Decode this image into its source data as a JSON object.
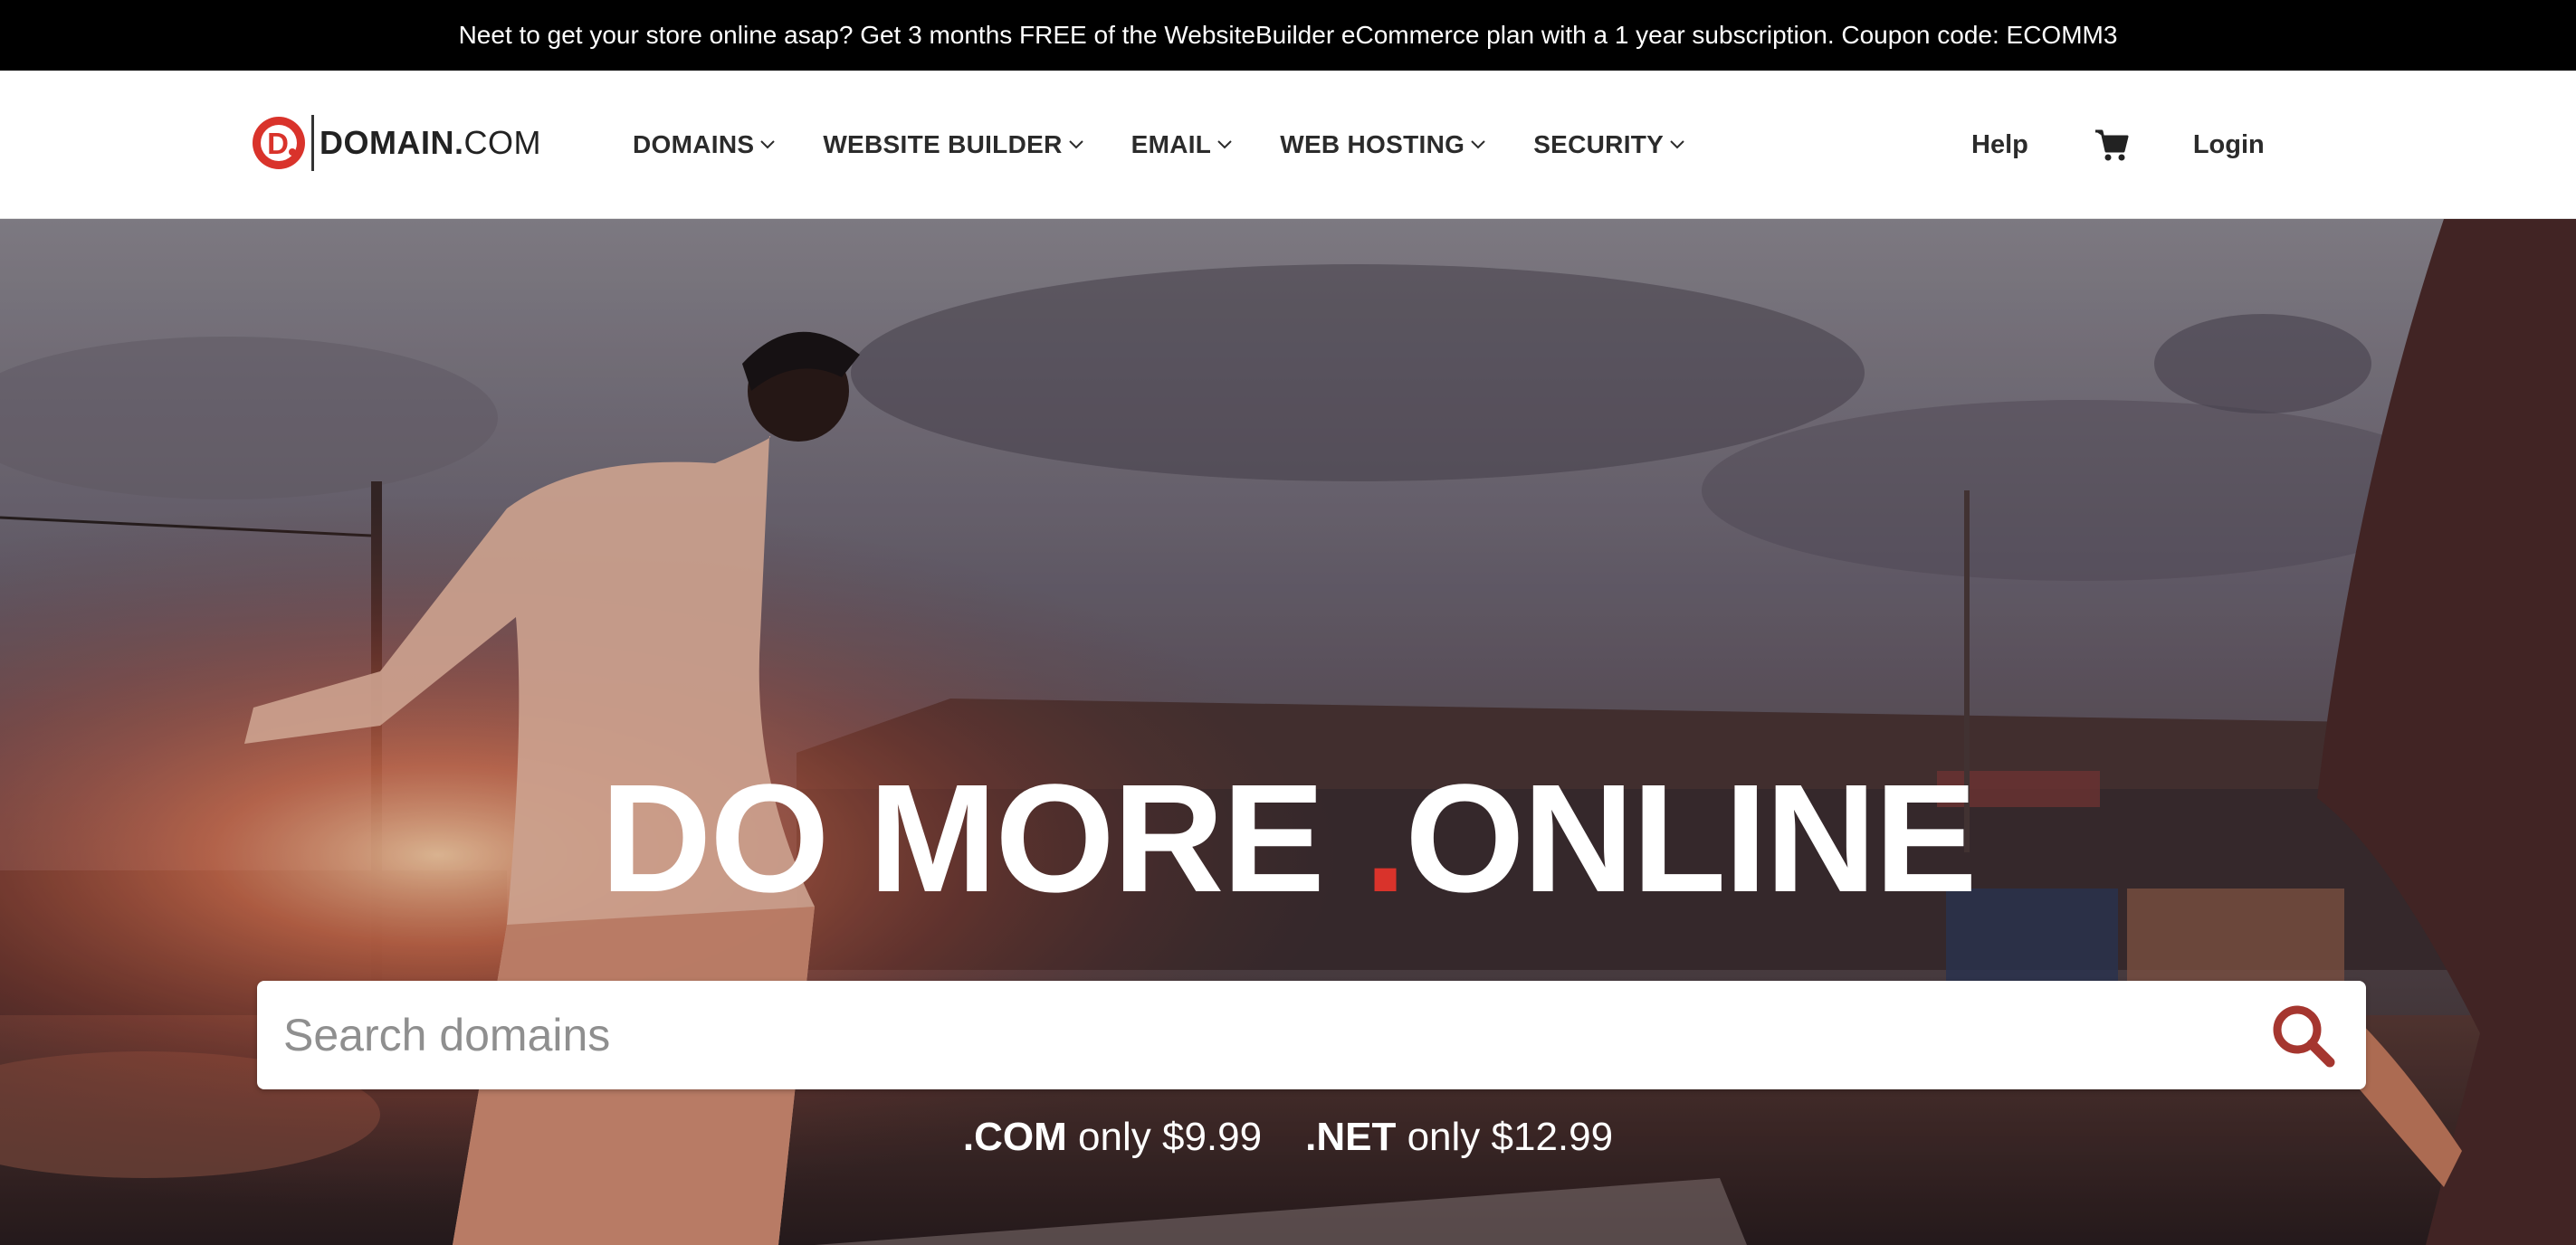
{
  "promo": {
    "text": "Neet to get your store online asap? Get 3 months FREE of the WebsiteBuilder eCommerce plan with a 1 year subscription. Coupon code: ECOMM3"
  },
  "header": {
    "logo": {
      "mark": "D.",
      "name_bold": "DOMAIN.",
      "name_rest": "COM"
    },
    "nav": [
      {
        "label": "DOMAINS"
      },
      {
        "label": "WEBSITE BUILDER"
      },
      {
        "label": "EMAIL"
      },
      {
        "label": "WEB HOSTING"
      },
      {
        "label": "SECURITY"
      }
    ],
    "help_label": "Help",
    "cart_icon": "shopping-cart-icon",
    "login_label": "Login"
  },
  "hero": {
    "headline_part1": "DO MORE",
    "headline_dot": ".",
    "headline_part2": "ONLINE",
    "search": {
      "placeholder": "Search domains",
      "value": ""
    },
    "prices": [
      {
        "tld": ".COM",
        "text": "only $9.99"
      },
      {
        "tld": ".NET",
        "text": "only $12.99"
      }
    ]
  },
  "colors": {
    "brand_red": "#d9332b",
    "promo_bg": "#000000",
    "nav_text": "#2b2b2b",
    "search_icon": "#a5362f"
  }
}
